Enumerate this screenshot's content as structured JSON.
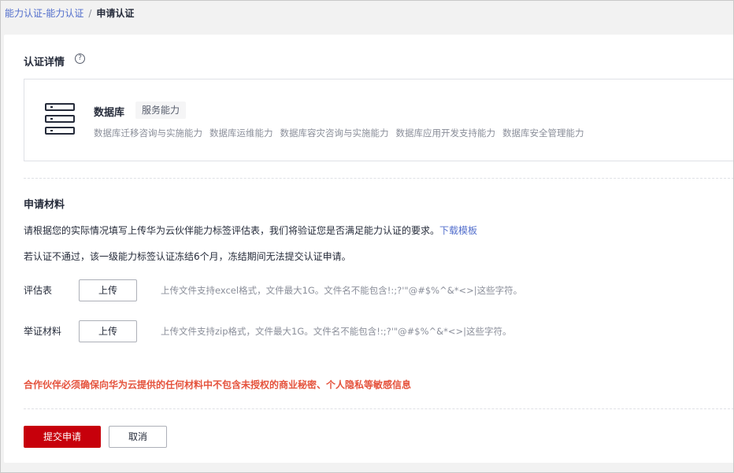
{
  "breadcrumb": {
    "parent": "能力认证-能力认证",
    "separator": "/",
    "current": "申请认证"
  },
  "detail": {
    "title": "认证详情",
    "help_icon": "question-circle-icon",
    "item_icon": "server-database-icon",
    "name": "数据库",
    "tag": "服务能力",
    "capabilities": [
      "数据库迁移咨询与实施能力",
      "数据库运维能力",
      "数据库容灾咨询与实施能力",
      "数据库应用开发支持能力",
      "数据库安全管理能力"
    ]
  },
  "materials": {
    "title": "申请材料",
    "description": "请根据您的实际情况填写上传华为云伙伴能力标签评估表，我们将验证您是否满足能力认证的要求。",
    "download_link": "下载模板",
    "notice": "若认证不通过，该一级能力标签认证冻结6个月，冻结期间无法提交认证申请。",
    "fields": [
      {
        "label": "评估表",
        "button": "上传",
        "hint": "上传文件支持excel格式，文件最大1G。文件名不能包含!:;?'\"@#$%^&*<>|这些字符。"
      },
      {
        "label": "举证材料",
        "button": "上传",
        "hint": "上传文件支持zip格式，文件最大1G。文件名不能包含!:;?'\"@#$%^&*<>|这些字符。"
      }
    ],
    "warning": "合作伙伴必须确保向华为云提供的任何材料中不包含未授权的商业秘密、个人隐私等敏感信息"
  },
  "actions": {
    "submit": "提交申请",
    "cancel": "取消"
  },
  "colors": {
    "primary": "#c7000b",
    "link": "#526ecc",
    "warning": "#e5533d",
    "text": "#252b3a",
    "secondary_text": "#8a8e99"
  }
}
